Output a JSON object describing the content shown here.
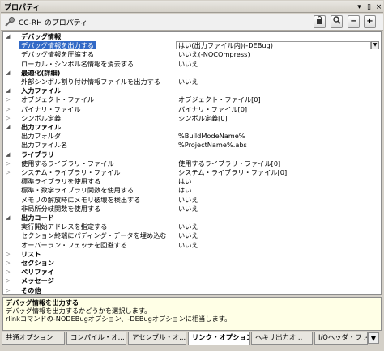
{
  "window": {
    "title": "プロパティ"
  },
  "toolbar": {
    "label": "CC-RH のプロパティ"
  },
  "rows": [
    {
      "kind": "cat",
      "exp": "◢",
      "name": "デバッグ情報",
      "val": ""
    },
    {
      "kind": "sel",
      "exp": "",
      "name": "デバッグ情報を出力する",
      "val": "はい(出力ファイル内)(-DEBug)"
    },
    {
      "kind": "item",
      "exp": "",
      "name": "デバッグ情報を圧縮する",
      "val": "いいえ(-NOCOmpress)"
    },
    {
      "kind": "item",
      "exp": "",
      "name": "ローカル・シンボル名情報を消去する",
      "val": "いいえ"
    },
    {
      "kind": "cat",
      "exp": "◢",
      "name": "最適化(詳細)",
      "val": ""
    },
    {
      "kind": "item",
      "exp": "",
      "name": "外部シンボル割り付け情報ファイルを出力する",
      "val": "いいえ"
    },
    {
      "kind": "cat",
      "exp": "◢",
      "name": "入力ファイル",
      "val": ""
    },
    {
      "kind": "item",
      "exp": "▷",
      "name": "オブジェクト・ファイル",
      "val": "オブジェクト・ファイル[0]"
    },
    {
      "kind": "item",
      "exp": "▷",
      "name": "バイナリ・ファイル",
      "val": "バイナリ・ファイル[0]"
    },
    {
      "kind": "item",
      "exp": "▷",
      "name": "シンボル定義",
      "val": "シンボル定義[0]"
    },
    {
      "kind": "cat",
      "exp": "◢",
      "name": "出力ファイル",
      "val": ""
    },
    {
      "kind": "item",
      "exp": "",
      "name": "出力フォルダ",
      "val": "%BuildModeName%"
    },
    {
      "kind": "item",
      "exp": "",
      "name": "出力ファイル名",
      "val": "%ProjectName%.abs"
    },
    {
      "kind": "cat",
      "exp": "◢",
      "name": "ライブラリ",
      "val": ""
    },
    {
      "kind": "item",
      "exp": "▷",
      "name": "使用するライブラリ・ファイル",
      "val": "使用するライブラリ・ファイル[0]"
    },
    {
      "kind": "item",
      "exp": "▷",
      "name": "システム・ライブラリ・ファイル",
      "val": "システム・ライブラリ・ファイル[0]"
    },
    {
      "kind": "item",
      "exp": "",
      "name": "標準ライブラリを使用する",
      "val": "はい"
    },
    {
      "kind": "item",
      "exp": "",
      "name": "標準・数学ライブラリ関数を使用する",
      "val": "はい"
    },
    {
      "kind": "item",
      "exp": "",
      "name": "メモリの解放時にメモリ破壊を検出する",
      "val": "いいえ"
    },
    {
      "kind": "item",
      "exp": "",
      "name": "非局所分岐関数を使用する",
      "val": "いいえ"
    },
    {
      "kind": "cat",
      "exp": "◢",
      "name": "出力コード",
      "val": ""
    },
    {
      "kind": "item",
      "exp": "",
      "name": "実行開始アドレスを指定する",
      "val": "いいえ"
    },
    {
      "kind": "item",
      "exp": "",
      "name": "セクション終端にパディング・データを埋め込む",
      "val": "いいえ"
    },
    {
      "kind": "item",
      "exp": "",
      "name": "オーバーラン・フェッチを回避する",
      "val": "いいえ"
    },
    {
      "kind": "cat",
      "exp": "▷",
      "name": "リスト",
      "val": ""
    },
    {
      "kind": "cat",
      "exp": "▷",
      "name": "セクション",
      "val": ""
    },
    {
      "kind": "cat",
      "exp": "▷",
      "name": "ベリファイ",
      "val": ""
    },
    {
      "kind": "cat",
      "exp": "▷",
      "name": "メッセージ",
      "val": ""
    },
    {
      "kind": "cat",
      "exp": "▷",
      "name": "その他",
      "val": ""
    }
  ],
  "description": {
    "title": "デバッグ情報を出力する",
    "line1": "デバッグ情報を出力するかどうかを選択します。",
    "line2": "rlinkコマンドの-NODEBugオプション、-DEBugオプションに相当します。"
  },
  "tabs": [
    "共通オプション",
    "コンパイル・オ...",
    "アセンブル・オ...",
    "リンク・オプション",
    "ヘキサ出力オ...",
    "I/Oヘッダ・ファ..."
  ],
  "active_tab": 3
}
